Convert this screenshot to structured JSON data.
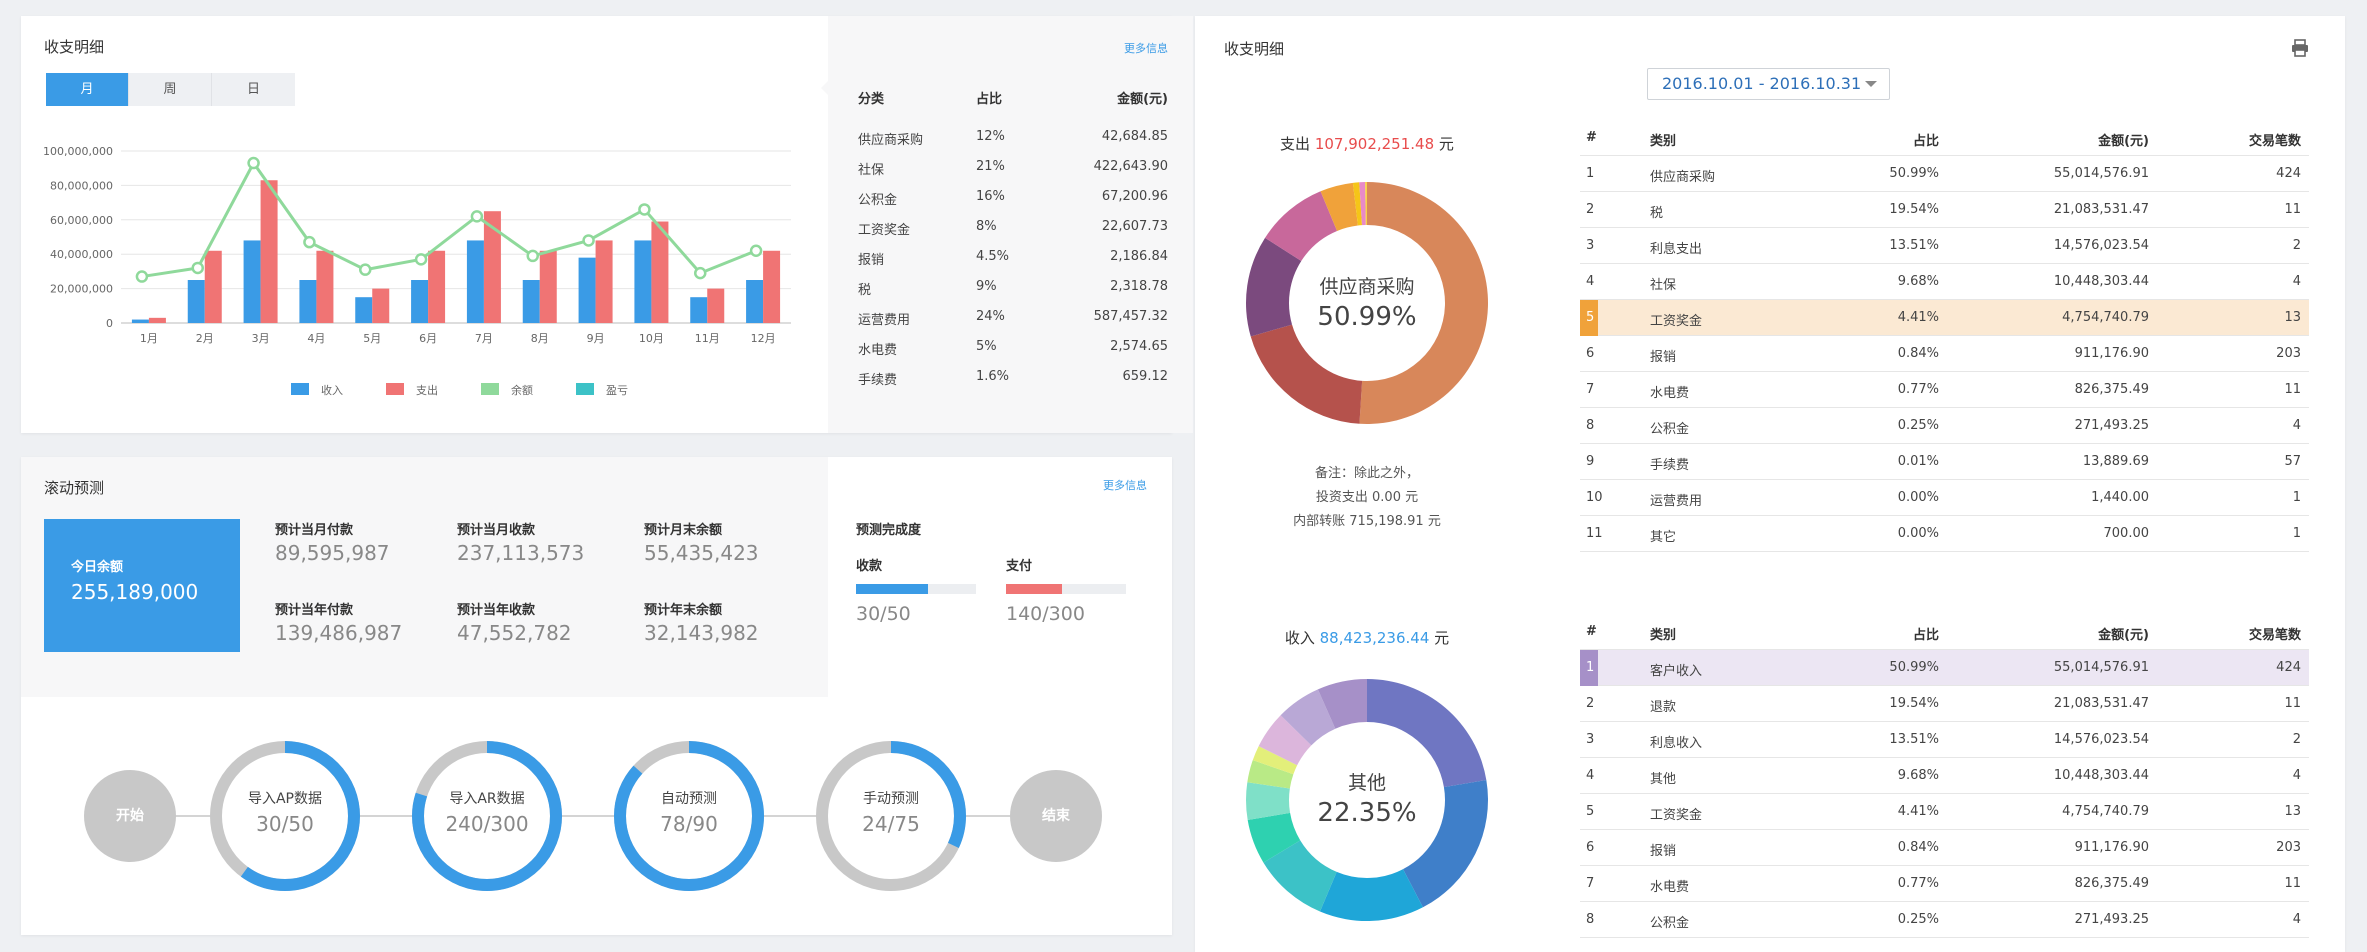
{
  "income_expense": {
    "title": "收支明细",
    "tabs": [
      "月",
      "周",
      "日"
    ],
    "more": "更多信息",
    "table": {
      "headers": [
        "分类",
        "占比",
        "金额(元)"
      ],
      "rows": [
        [
          "供应商采购",
          "12%",
          "42,684.85"
        ],
        [
          "社保",
          "21%",
          "422,643.90"
        ],
        [
          "公积金",
          "16%",
          "67,200.96"
        ],
        [
          "工资奖金",
          "8%",
          "22,607.73"
        ],
        [
          "报销",
          "4.5%",
          "2,186.84"
        ],
        [
          "税",
          "9%",
          "2,318.78"
        ],
        [
          "运营费用",
          "24%",
          "587,457.32"
        ],
        [
          "水电费",
          "5%",
          "2,574.65"
        ],
        [
          "手续费",
          "1.6%",
          "659.12"
        ]
      ]
    }
  },
  "chart_data": {
    "type": "bar",
    "categories": [
      "1月",
      "2月",
      "3月",
      "4月",
      "5月",
      "6月",
      "7月",
      "8月",
      "9月",
      "10月",
      "11月",
      "12月"
    ],
    "series": [
      {
        "name": "收入",
        "type": "bar",
        "color": "#3a9be6",
        "values": [
          2000000,
          25000000,
          48000000,
          25000000,
          15000000,
          25000000,
          48000000,
          25000000,
          38000000,
          48000000,
          15000000,
          25000000
        ]
      },
      {
        "name": "支出",
        "type": "bar",
        "color": "#f07474",
        "values": [
          3000000,
          42000000,
          83000000,
          42000000,
          20000000,
          42000000,
          65000000,
          42000000,
          48000000,
          59000000,
          20000000,
          42000000
        ]
      },
      {
        "name": "余额",
        "type": "line",
        "color": "#8fd99b",
        "values": [
          27000000,
          32000000,
          93000000,
          47000000,
          31000000,
          37000000,
          62000000,
          39000000,
          48000000,
          66000000,
          29000000,
          42000000
        ]
      },
      {
        "name": "盈亏",
        "type": "none",
        "color": "#3cc2c7",
        "values": []
      }
    ],
    "yticks": [
      "100,000,000",
      "80,000,000",
      "60,000,000",
      "40,000,000",
      "20,000,000",
      "0"
    ],
    "ylim": [
      0,
      100000000
    ],
    "grid": true,
    "legend": "bottom"
  },
  "forecast": {
    "title": "滚动预测",
    "more": "更多信息",
    "today_label": "今日余额",
    "today_value": "255,189,000",
    "stats": [
      {
        "label": "预计当月付款",
        "value": "89,595,987"
      },
      {
        "label": "预计当月收款",
        "value": "237,113,573"
      },
      {
        "label": "预计月末余额",
        "value": "55,435,423"
      },
      {
        "label": "预计当年付款",
        "value": "139,486,987"
      },
      {
        "label": "预计当年收款",
        "value": "47,552,782"
      },
      {
        "label": "预计年末余额",
        "value": "32,143,982"
      }
    ],
    "completion_title": "预测完成度",
    "progress": [
      {
        "label": "收款",
        "value": "30/50",
        "fraction": 0.6,
        "color": "#3a9be6"
      },
      {
        "label": "支付",
        "value": "140/300",
        "fraction": 0.47,
        "color": "#f07474"
      }
    ]
  },
  "flow": {
    "start": "开始",
    "end": "结束",
    "steps": [
      {
        "label": "导入AP数据",
        "count": "30/50",
        "fraction": 0.6
      },
      {
        "label": "导入AR数据",
        "count": "240/300",
        "fraction": 0.8
      },
      {
        "label": "自动预测",
        "count": "78/90",
        "fraction": 0.867
      },
      {
        "label": "手动预测",
        "count": "24/75",
        "fraction": 0.32
      }
    ]
  },
  "detail": {
    "title": "收支明细",
    "date_range": "2016.10.01 - 2016.10.31",
    "print_icon": "printer-icon",
    "expense": {
      "prefix": "支出",
      "amount": "107,902,251.48",
      "unit": "元",
      "center_name": "供应商采购",
      "center_pct": "50.99%",
      "slices": [
        {
          "value": 50.99,
          "color": "#d8875a"
        },
        {
          "value": 19.54,
          "color": "#b5524c"
        },
        {
          "value": 13.51,
          "color": "#7b4a7e"
        },
        {
          "value": 9.68,
          "color": "#c8689b"
        },
        {
          "value": 4.41,
          "color": "#f0a23a"
        },
        {
          "value": 0.84,
          "color": "#f5c518"
        },
        {
          "value": 0.77,
          "color": "#e88ac8"
        },
        {
          "value": 0.25,
          "color": "#f7d24a"
        }
      ],
      "notes": [
        "备注：除此之外，",
        "投资支出 0.00 元",
        "内部转账 715,198.91 元"
      ],
      "headers": [
        "#",
        "类别",
        "占比",
        "金额(元)",
        "交易笔数"
      ],
      "rows": [
        [
          "1",
          "供应商采购",
          "50.99%",
          "55,014,576.91",
          "424"
        ],
        [
          "2",
          "税",
          "19.54%",
          "21,083,531.47",
          "11"
        ],
        [
          "3",
          "利息支出",
          "13.51%",
          "14,576,023.54",
          "2"
        ],
        [
          "4",
          "社保",
          "9.68%",
          "10,448,303.44",
          "4"
        ],
        [
          "5",
          "工资奖金",
          "4.41%",
          "4,754,740.79",
          "13"
        ],
        [
          "6",
          "报销",
          "0.84%",
          "911,176.90",
          "203"
        ],
        [
          "7",
          "水电费",
          "0.77%",
          "826,375.49",
          "11"
        ],
        [
          "8",
          "公积金",
          "0.25%",
          "271,493.25",
          "4"
        ],
        [
          "9",
          "手续费",
          "0.01%",
          "13,889.69",
          "57"
        ],
        [
          "10",
          "运营费用",
          "0.00%",
          "1,440.00",
          "1"
        ],
        [
          "11",
          "其它",
          "0.00%",
          "700.00",
          "1"
        ]
      ],
      "highlight_row": 4,
      "highlight_color": "#fbe9d3",
      "marker_color": "#f0a23a"
    },
    "income": {
      "prefix": "收入",
      "amount": "88,423,236.44",
      "unit": "元",
      "center_name": "其他",
      "center_pct": "22.35%",
      "slices": [
        {
          "value": 22.35,
          "color": "#6f76c2"
        },
        {
          "value": 20,
          "color": "#3f7fc9"
        },
        {
          "value": 14,
          "color": "#1fa6d8"
        },
        {
          "value": 10,
          "color": "#3cc2c7"
        },
        {
          "value": 6,
          "color": "#2ed1b0"
        },
        {
          "value": 5,
          "color": "#7fe0c8"
        },
        {
          "value": 3,
          "color": "#b9ea86"
        },
        {
          "value": 2,
          "color": "#e3ef7a"
        },
        {
          "value": 5,
          "color": "#dcb6dc"
        },
        {
          "value": 6,
          "color": "#b9a8d6"
        },
        {
          "value": 6.65,
          "color": "#a690c8"
        }
      ],
      "headers": [
        "#",
        "类别",
        "占比",
        "金额(元)",
        "交易笔数"
      ],
      "rows": [
        [
          "1",
          "客户收入",
          "50.99%",
          "55,014,576.91",
          "424"
        ],
        [
          "2",
          "退款",
          "19.54%",
          "21,083,531.47",
          "11"
        ],
        [
          "3",
          "利息收入",
          "13.51%",
          "14,576,023.54",
          "2"
        ],
        [
          "4",
          "其他",
          "9.68%",
          "10,448,303.44",
          "4"
        ],
        [
          "5",
          "工资奖金",
          "4.41%",
          "4,754,740.79",
          "13"
        ],
        [
          "6",
          "报销",
          "0.84%",
          "911,176.90",
          "203"
        ],
        [
          "7",
          "水电费",
          "0.77%",
          "826,375.49",
          "11"
        ],
        [
          "8",
          "公积金",
          "0.25%",
          "271,493.25",
          "4"
        ]
      ],
      "highlight_row": 0,
      "highlight_color": "#ece6f3",
      "marker_color": "#a690c8"
    }
  }
}
